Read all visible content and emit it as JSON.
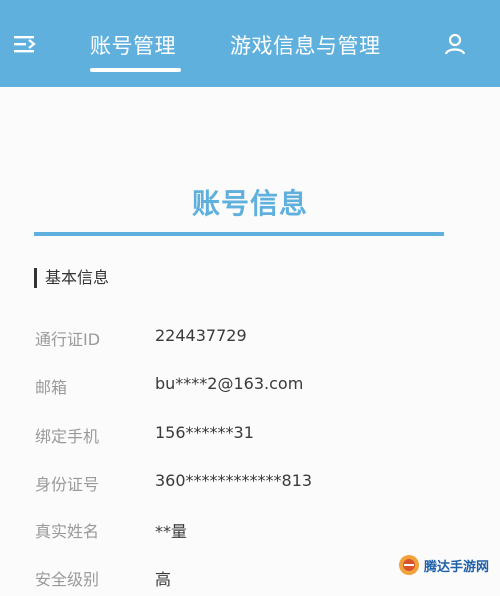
{
  "header": {
    "tabs": [
      {
        "label": "账号管理",
        "active": true
      },
      {
        "label": "游戏信息与管理",
        "active": false
      }
    ],
    "menu_icon": "menu-icon",
    "user_icon": "user-icon",
    "accent_color": "#5fb0dd"
  },
  "main": {
    "title": "账号信息",
    "section_title": "基本信息",
    "rows": [
      {
        "label": "通行证ID",
        "value": "224437729"
      },
      {
        "label": "邮箱",
        "value": "bu****2@163.com"
      },
      {
        "label": "绑定手机",
        "value": "156******31"
      },
      {
        "label": "身份证号",
        "value": "360************813"
      },
      {
        "label": "真实姓名",
        "value": "**量"
      },
      {
        "label": "安全级别",
        "value": "高"
      }
    ]
  },
  "watermark": {
    "text": "腾达手游网"
  }
}
